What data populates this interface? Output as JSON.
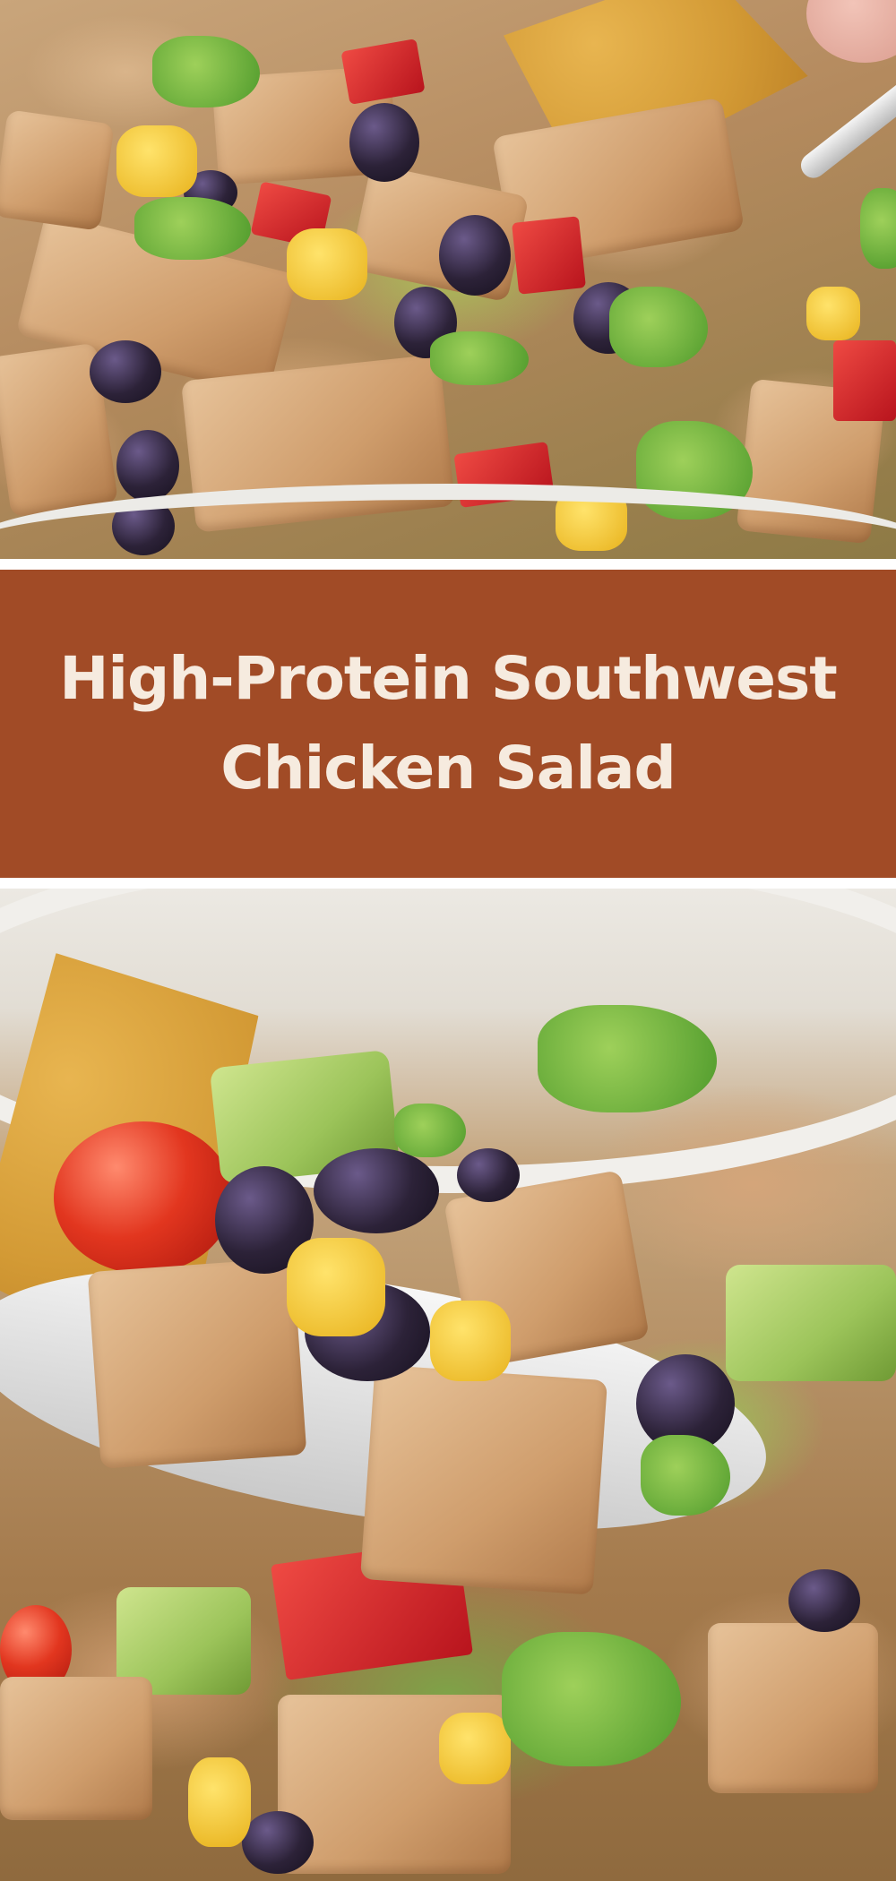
{
  "title": {
    "line1": "High-Protein Southwest",
    "line2": "Chicken Salad"
  },
  "colors": {
    "banner_background": "#a14b26",
    "banner_text": "#f6ebdf",
    "page_background": "#ffffff"
  },
  "images": {
    "top_photo": "southwest-chicken-salad-bowl-photo",
    "bottom_photo": "southwest-chicken-salad-spoon-closeup-photo"
  }
}
